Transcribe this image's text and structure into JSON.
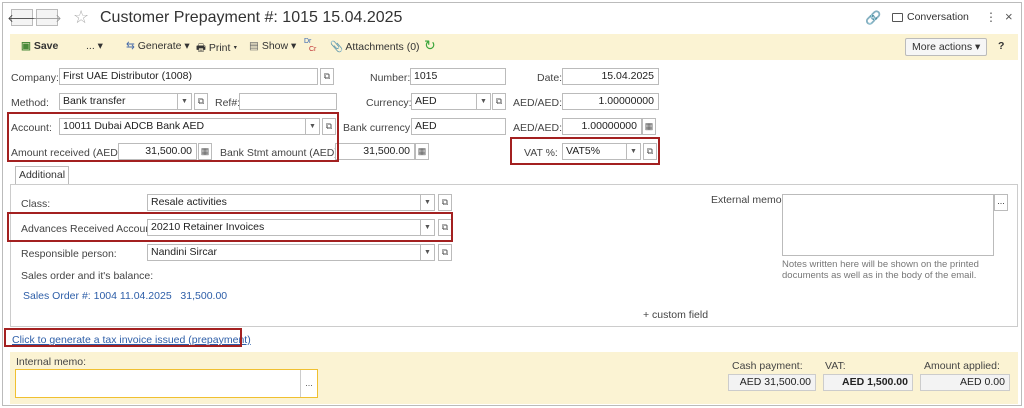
{
  "window": {
    "title": "Customer Prepayment #: 1015 15.04.2025",
    "conversation_label": "Conversation"
  },
  "toolbar": {
    "save": "Save",
    "more_dots": "...",
    "generate": "Generate",
    "print": "Print",
    "show": "Show",
    "dtcr_top": "Dr",
    "dtcr_bottom": "Cr",
    "attachments": "Attachments (0)",
    "more_actions": "More actions",
    "help": "?"
  },
  "fields": {
    "company": {
      "label": "Company:",
      "value": "First UAE Distributor (1008)"
    },
    "number": {
      "label": "Number:",
      "value": "1015"
    },
    "date": {
      "label": "Date:",
      "value": "15.04.2025"
    },
    "method": {
      "label": "Method:",
      "value": "Bank transfer"
    },
    "ref": {
      "label": "Ref#:",
      "value": ""
    },
    "currency": {
      "label": "Currency:",
      "value": "AED"
    },
    "rate1": {
      "label": "AED/AED:",
      "value": "1.00000000"
    },
    "account": {
      "label": "Account:",
      "value": "10011 Dubai ADCB Bank AED"
    },
    "bank_currency": {
      "label": "Bank currency:",
      "value": "AED"
    },
    "rate2": {
      "label": "AED/AED:",
      "value": "1.00000000"
    },
    "amount_received": {
      "label": "Amount received (AED):",
      "value": "31,500.00"
    },
    "bank_stmt": {
      "label": "Bank Stmt amount (AED):",
      "value": "31,500.00"
    },
    "vat": {
      "label": "VAT %:",
      "value": "VAT5%"
    }
  },
  "tabs": [
    "Additional"
  ],
  "additional": {
    "class": {
      "label": "Class:",
      "value": "Resale activities"
    },
    "advances": {
      "label": "Advances Received Account:",
      "value": "20210 Retainer Invoices"
    },
    "responsible": {
      "label": "Responsible person:",
      "value": "Nandini Sircar"
    },
    "sales_order_label": "Sales order and it's balance:",
    "sales_order_link": "Sales Order #: 1004 11.04.2025   31,500.00",
    "external_memo_label": "External memo:",
    "external_memo_note": "Notes written here will be shown on the printed documents as well as in the body of the email.",
    "custom_field": "+ custom field"
  },
  "tax_invoice_link": "Click to generate a tax invoice issued (prepayment)",
  "footer": {
    "internal_memo_label": "Internal memo:",
    "cash_payment_label": "Cash payment:",
    "cash_payment": "AED 31,500.00",
    "vat_label": "VAT:",
    "vat": "AED 1,500.00",
    "amount_applied_label": "Amount applied:",
    "amount_applied": "AED 0.00"
  },
  "colors": {
    "toolbar_bg": "#fbf3d3",
    "highlight": "#a32020",
    "link": "#2d5ea8",
    "memo_border": "#f0c030",
    "refresh": "#3aa53a"
  }
}
